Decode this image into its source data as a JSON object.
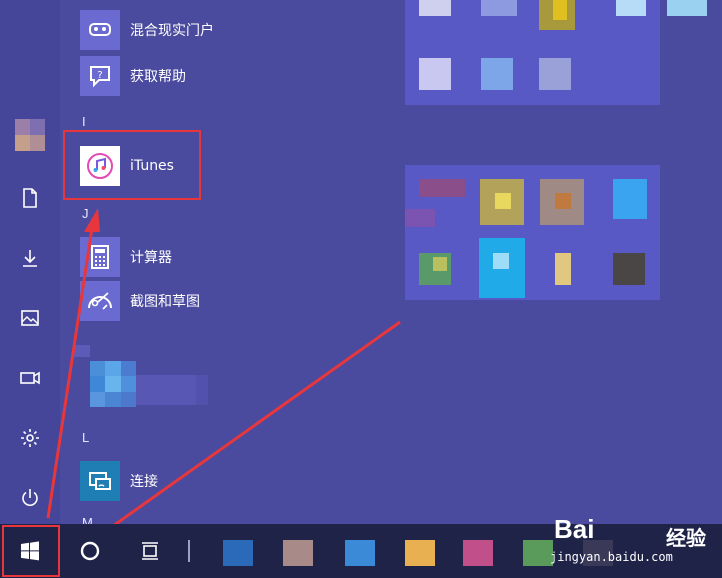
{
  "start_menu": {
    "sidebar": {
      "buttons": [
        "avatar",
        "document-icon",
        "download-icon",
        "pictures-icon",
        "video-icon",
        "settings-icon",
        "power-icon"
      ]
    },
    "app_list": {
      "apps": [
        {
          "label": "混合现实门户",
          "icon": "mixed-reality-icon"
        },
        {
          "label": "获取帮助",
          "icon": "get-help-icon"
        },
        {
          "label": "iTunes",
          "icon": "itunes-icon"
        },
        {
          "label": "计算器",
          "icon": "calculator-icon"
        },
        {
          "label": "截图和草图",
          "icon": "snip-sketch-icon"
        },
        {
          "label": "连接",
          "icon": "connect-icon"
        }
      ],
      "letters": [
        "I",
        "J",
        "L",
        "M"
      ]
    }
  },
  "taskbar": {
    "items": [
      "start-button",
      "cortana-button",
      "task-view-button"
    ]
  },
  "watermark": {
    "main": "Bai",
    "cn": "经验",
    "url": "jingyan.baidu.com"
  },
  "colors": {
    "background": "#4a4a9e",
    "tile_blue": "#5a5ac4",
    "highlight": "#e8373c",
    "taskbar": "#1f2347"
  }
}
